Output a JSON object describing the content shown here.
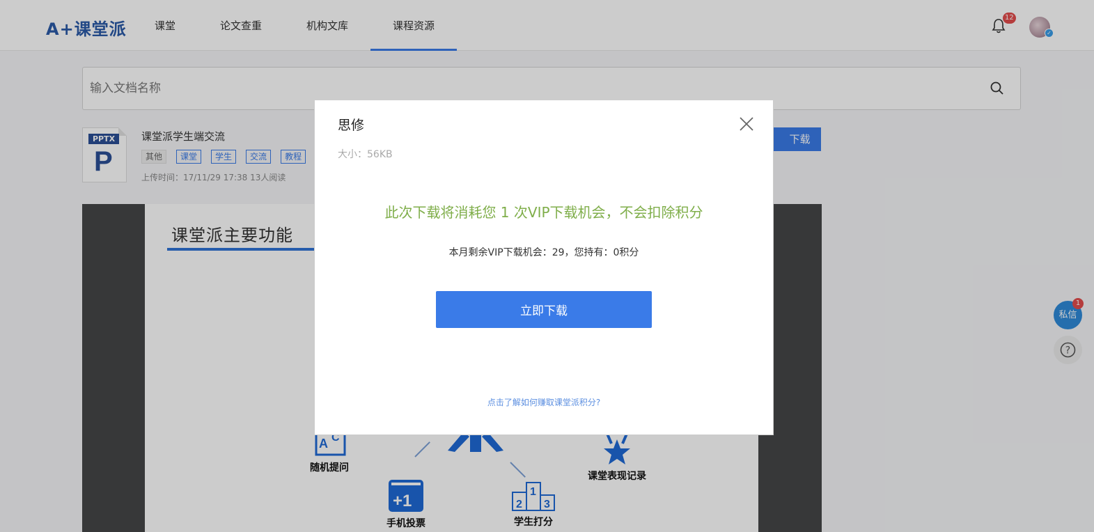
{
  "header": {
    "logo": "课堂派",
    "logo_prefix": "A+",
    "nav": [
      {
        "label": "课堂"
      },
      {
        "label": "论文查重"
      },
      {
        "label": "机构文库"
      },
      {
        "label": "课程资源"
      }
    ],
    "notification_count": "12",
    "bell_icon": "bell-icon",
    "avatar_check": "✓"
  },
  "search": {
    "placeholder": "输入文档名称",
    "icon": "search-icon"
  },
  "document": {
    "ext": "PPTX",
    "ext_letter": "P",
    "title": "课堂派学生端交流",
    "tags": [
      "其他",
      "课堂",
      "学生",
      "交流",
      "教程"
    ],
    "meta": "上传时间：17/11/29 17:38 13人阅读",
    "download_label": "下载"
  },
  "slide": {
    "title": "课堂派主要功能",
    "features": [
      {
        "label": "随机提问"
      },
      {
        "label": "手机投票"
      },
      {
        "label": "学生打分"
      },
      {
        "label": "课堂表现记录"
      }
    ]
  },
  "modal": {
    "title": "思修",
    "size": "大小：56KB",
    "message": "此次下载将消耗您 1 次VIP下载机会，不会扣除积分",
    "sub": "本月剩余VIP下载机会：29，您持有：0积分",
    "button": "立即下载",
    "link": "点击了解如何赚取课堂派积分?"
  },
  "float": {
    "pm_label": "私信",
    "pm_badge": "1",
    "help": "?"
  },
  "colors": {
    "primary": "#3a7be8",
    "highlight": "#7fae4a",
    "badge": "#e34d4d"
  }
}
